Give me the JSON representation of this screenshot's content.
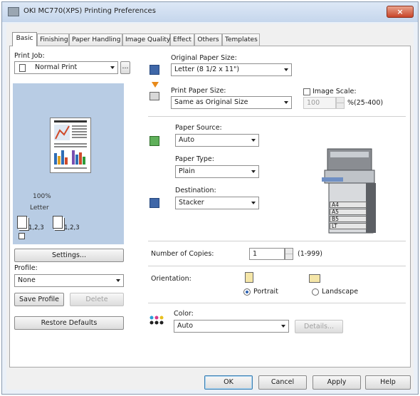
{
  "window": {
    "title": "OKI MC770(XPS) Printing Preferences",
    "close_label": "×"
  },
  "tabs": [
    {
      "label": "Basic"
    },
    {
      "label": "Finishing"
    },
    {
      "label": "Paper Handling"
    },
    {
      "label": "Image Quality"
    },
    {
      "label": "Effect"
    },
    {
      "label": "Others"
    },
    {
      "label": "Templates"
    }
  ],
  "left": {
    "print_job_label": "Print Job:",
    "print_job_value": "Normal Print",
    "more_label": "...",
    "zoom_text": "100%",
    "paper_text": "Letter",
    "collate_label_a": "1,2,3",
    "collate_label_b": "1,2,3",
    "settings_label": "Settings...",
    "profile_label": "Profile:",
    "profile_value": "None",
    "save_profile_label": "Save Profile",
    "delete_label": "Delete",
    "restore_defaults_label": "Restore Defaults"
  },
  "paper": {
    "original_label": "Original Paper Size:",
    "original_value": "Letter (8 1/2 x 11\")",
    "print_label": "Print Paper Size:",
    "print_value": "Same as Original Size",
    "image_scale_label": "Image Scale:",
    "image_scale_value": "100",
    "image_scale_range": "%(25-400)"
  },
  "source": {
    "paper_source_label": "Paper Source:",
    "paper_source_value": "Auto",
    "paper_type_label": "Paper Type:",
    "paper_type_value": "Plain",
    "destination_label": "Destination:",
    "destination_value": "Stacker"
  },
  "printer_trays": [
    "A4",
    "A5",
    "B5",
    "LT"
  ],
  "copies": {
    "label": "Number of Copies:",
    "value": "1",
    "range": "(1-999)"
  },
  "orientation": {
    "label": "Orientation:",
    "portrait_label": "Portrait",
    "landscape_label": "Landscape",
    "selected": "portrait"
  },
  "color": {
    "label": "Color:",
    "value": "Auto",
    "details_label": "Details..."
  },
  "footer": {
    "ok_label": "OK",
    "cancel_label": "Cancel",
    "apply_label": "Apply",
    "help_label": "Help"
  },
  "colors": {
    "preview_bg": "#b8cce4",
    "close_red": "#c8452a",
    "accent_blue": "#2b5fb0",
    "arrow_orange": "#e88a1a"
  }
}
